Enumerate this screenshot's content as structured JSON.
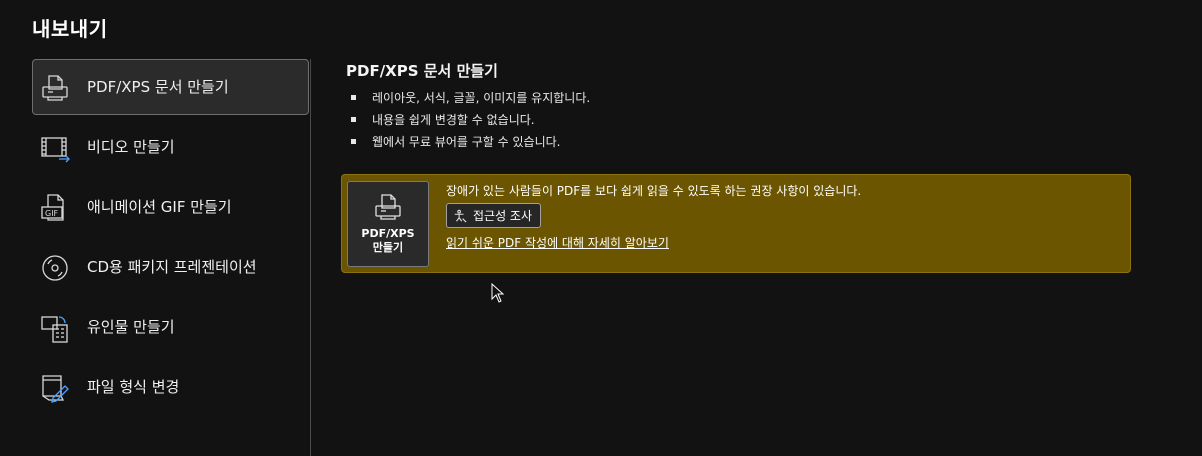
{
  "page_title": "내보내기",
  "nav": {
    "items": [
      {
        "label": "PDF/XPS 문서 만들기",
        "icon": "pdf-document-icon",
        "selected": true
      },
      {
        "label": "비디오 만들기",
        "icon": "video-icon"
      },
      {
        "label": "애니메이션 GIF 만들기",
        "icon": "gif-icon"
      },
      {
        "label": "CD용 패키지 프레젠테이션",
        "icon": "cd-package-icon"
      },
      {
        "label": "유인물 만들기",
        "icon": "handout-icon"
      },
      {
        "label": "파일 형식 변경",
        "icon": "change-file-type-icon"
      }
    ]
  },
  "content": {
    "title": "PDF/XPS 문서 만들기",
    "bullets": [
      "레이아웃, 서식, 글꼴, 이미지를 유지합니다.",
      "내용을 쉽게 변경할 수 없습니다.",
      "웹에서 무료 뷰어를 구할 수 있습니다."
    ]
  },
  "banner": {
    "create_button": {
      "line1": "PDF/XPS",
      "line2": "만들기"
    },
    "message": "장애가 있는 사람들이 PDF를 보다 쉽게 읽을 수 있도록 하는 권장 사항이 있습니다.",
    "check_button": "접근성 조사",
    "learn_link": "읽기 쉬운 PDF 작성에 대해 자세히 알아보기",
    "background_color": "#6b5500"
  }
}
